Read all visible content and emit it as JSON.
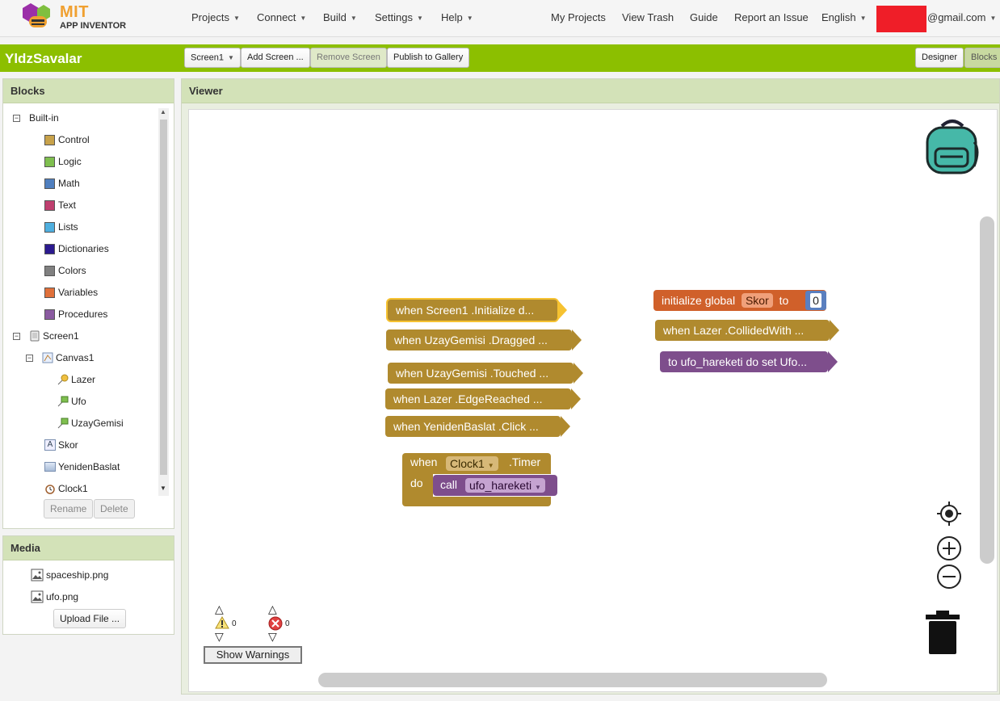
{
  "header": {
    "logo": {
      "title": "MIT",
      "subtitle": "APP INVENTOR"
    },
    "menus": [
      "Projects",
      "Connect",
      "Build",
      "Settings",
      "Help"
    ],
    "links": [
      "My Projects",
      "View Trash",
      "Guide",
      "Report an Issue"
    ],
    "language": "English",
    "account": "@gmail.com"
  },
  "project": {
    "name": "YldzSavalar",
    "screen_select": "Screen1",
    "add_screen": "Add Screen ...",
    "remove_screen": "Remove Screen",
    "publish": "Publish to Gallery",
    "designer": "Designer",
    "blocks": "Blocks"
  },
  "blocks_panel": {
    "title": "Blocks",
    "builtin_label": "Built-in",
    "builtin": [
      {
        "label": "Control",
        "color": "#c8a24a"
      },
      {
        "label": "Logic",
        "color": "#7fbf4f"
      },
      {
        "label": "Math",
        "color": "#4f7fbf"
      },
      {
        "label": "Text",
        "color": "#bf3f6f"
      },
      {
        "label": "Lists",
        "color": "#4fafdf"
      },
      {
        "label": "Dictionaries",
        "color": "#2b1a8f"
      },
      {
        "label": "Colors",
        "color": "#808080"
      },
      {
        "label": "Variables",
        "color": "#e0703a"
      },
      {
        "label": "Procedures",
        "color": "#8a5aa0"
      }
    ],
    "screen": "Screen1",
    "canvas": "Canvas1",
    "canvas_children": [
      "Lazer",
      "Ufo",
      "UzayGemisi"
    ],
    "components": [
      "Skor",
      "YenidenBaslat",
      "Clock1"
    ],
    "rename": "Rename",
    "delete": "Delete"
  },
  "media_panel": {
    "title": "Media",
    "files": [
      "spaceship.png",
      "ufo.png"
    ],
    "upload": "Upload File ..."
  },
  "viewer": {
    "title": "Viewer",
    "show_warnings": "Show Warnings",
    "warnings_count": "0",
    "errors_count": "0",
    "blocks": {
      "screen1_init": "when  Screen1 .Initialize  d...",
      "uzay_dragged": "when  UzayGemisi .Dragged  ...",
      "uzay_touched": "when  UzayGemisi .Touched  ...",
      "lazer_edge": "when  Lazer .EdgeReached  ...",
      "yeniden_click": "when  YenidenBaslat .Click  ...",
      "clock_when": "when",
      "clock_component": "Clock1",
      "clock_event": ".Timer",
      "clock_do": "do",
      "call_label": "call",
      "call_proc": "ufo_hareketi",
      "global_init": "initialize global",
      "global_name": "Skor",
      "global_to": "to",
      "global_value": "0",
      "lazer_collided": "when  Lazer .CollidedWith  ...",
      "ufo_proc": "to ufo_hareketi do set  Ufo..."
    }
  }
}
